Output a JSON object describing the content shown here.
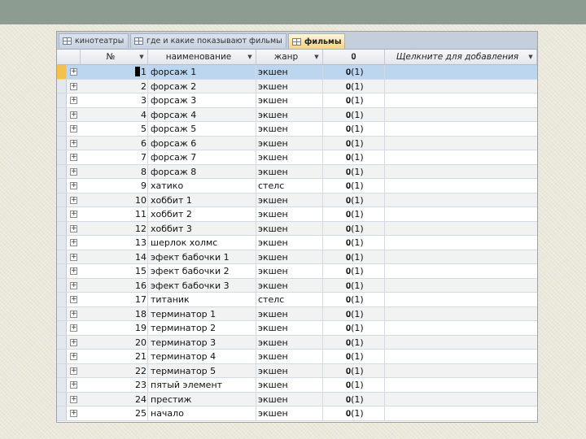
{
  "tabs": [
    {
      "label": "кинотеатры",
      "active": false
    },
    {
      "label": "где и какие показывают фильмы",
      "active": false
    },
    {
      "label": "фильмы",
      "active": true
    }
  ],
  "columns": {
    "num": "№",
    "name": "наименование",
    "genre": "жанр",
    "attachment_icon": "paperclip-icon",
    "add": "Щелкните для добавления"
  },
  "rows": [
    {
      "num": "1",
      "name": "форсаж 1",
      "genre": "экшен",
      "att": "(1)"
    },
    {
      "num": "2",
      "name": "форсаж 2",
      "genre": "экшен",
      "att": "(1)"
    },
    {
      "num": "3",
      "name": "форсаж 3",
      "genre": "экшен",
      "att": "(1)"
    },
    {
      "num": "4",
      "name": "форсаж 4",
      "genre": "экшен",
      "att": "(1)"
    },
    {
      "num": "5",
      "name": "форсаж 5",
      "genre": "экшен",
      "att": "(1)"
    },
    {
      "num": "6",
      "name": "форсаж 6",
      "genre": "экшен",
      "att": "(1)"
    },
    {
      "num": "7",
      "name": "форсаж 7",
      "genre": "экшен",
      "att": "(1)"
    },
    {
      "num": "8",
      "name": "форсаж 8",
      "genre": "экшен",
      "att": "(1)"
    },
    {
      "num": "9",
      "name": "хатико",
      "genre": "стелс",
      "att": "(1)"
    },
    {
      "num": "10",
      "name": "хоббит 1",
      "genre": "экшен",
      "att": "(1)"
    },
    {
      "num": "11",
      "name": "хоббит 2",
      "genre": "экшен",
      "att": "(1)"
    },
    {
      "num": "12",
      "name": "хоббит 3",
      "genre": "экшен",
      "att": "(1)"
    },
    {
      "num": "13",
      "name": "шерлок холмс",
      "genre": "экшен",
      "att": "(1)"
    },
    {
      "num": "14",
      "name": "эфект бабочки 1",
      "genre": "экшен",
      "att": "(1)"
    },
    {
      "num": "15",
      "name": "эфект бабочки 2",
      "genre": "экшен",
      "att": "(1)"
    },
    {
      "num": "16",
      "name": "эфект бабочки 3",
      "genre": "экшен",
      "att": "(1)"
    },
    {
      "num": "17",
      "name": "титаник",
      "genre": "стелс",
      "att": "(1)"
    },
    {
      "num": "18",
      "name": "терминатор 1",
      "genre": "экшен",
      "att": "(1)"
    },
    {
      "num": "19",
      "name": "терминатор 2",
      "genre": "экшен",
      "att": "(1)"
    },
    {
      "num": "20",
      "name": "терминатор 3",
      "genre": "экшен",
      "att": "(1)"
    },
    {
      "num": "21",
      "name": "терминатор 4",
      "genre": "экшен",
      "att": "(1)"
    },
    {
      "num": "22",
      "name": "терминатор 5",
      "genre": "экшен",
      "att": "(1)"
    },
    {
      "num": "23",
      "name": "пятый элемент",
      "genre": "экшен",
      "att": "(1)"
    },
    {
      "num": "24",
      "name": "престиж",
      "genre": "экшен",
      "att": "(1)"
    },
    {
      "num": "25",
      "name": "начало",
      "genre": "экшен",
      "att": "(1)"
    }
  ],
  "selected_row_index": 0,
  "colors": {
    "top_bar": "#8c9c90",
    "active_tab": "#f7d37d",
    "selected_row": "#bcd6ef",
    "row_selector": "#f2c24a"
  }
}
